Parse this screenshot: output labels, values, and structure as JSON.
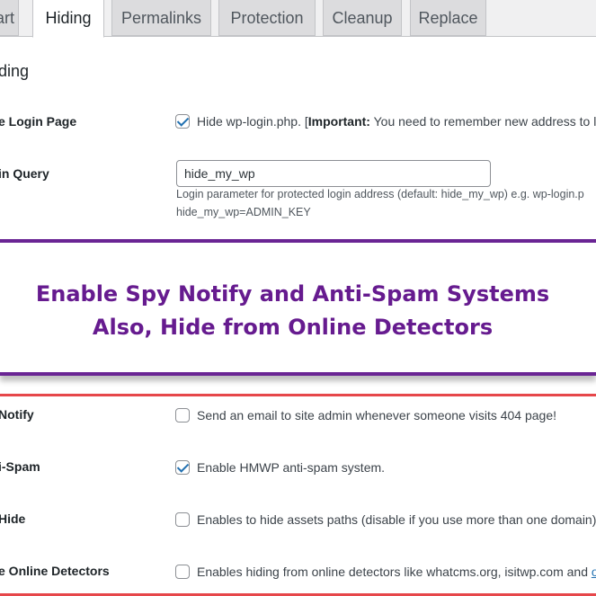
{
  "tabs": [
    {
      "label": "art",
      "active": false
    },
    {
      "label": "Hiding",
      "active": true
    },
    {
      "label": "Permalinks",
      "active": false
    },
    {
      "label": "Protection",
      "active": false
    },
    {
      "label": "Cleanup",
      "active": false
    },
    {
      "label": "Replace",
      "active": false
    }
  ],
  "section": {
    "title": "ding"
  },
  "rows": {
    "login_page": {
      "label": "e Login Page",
      "checked": true,
      "text_before": "Hide wp-login.php. [",
      "important": "Important:",
      "text_after": " You need to remember new address to l"
    },
    "login_query": {
      "label": "in Query",
      "value": "hide_my_wp",
      "help_line1": "Login parameter for protected login address (default: hide_my_wp) e.g. wp-login.p",
      "help_line2": "hide_my_wp=ADMIN_KEY"
    },
    "spy_notify": {
      "label": "Notify",
      "checked": false,
      "text": "Send an email to site admin whenever someone visits 404 page!"
    },
    "anti_spam": {
      "label": "i-Spam",
      "checked": true,
      "text": "Enable HMWP anti-spam system."
    },
    "hide": {
      "label": "Hide",
      "checked": false,
      "text": "Enables to hide assets paths (disable if you use more than one domain)"
    },
    "online_detectors": {
      "label": "e Online Detectors",
      "checked": false,
      "text": "Enables hiding from online detectors like whatcms.org, isitwp.com and ",
      "link": "o"
    }
  },
  "banner": {
    "line1": "Enable Spy Notify and Anti-Spam Systems",
    "line2": "Also, Hide from Online Detectors",
    "text_color": "#661b8f",
    "border_color": "#6a2594"
  },
  "colors": {
    "accent": "#2271b1",
    "highlight_line": "#e6474a"
  }
}
